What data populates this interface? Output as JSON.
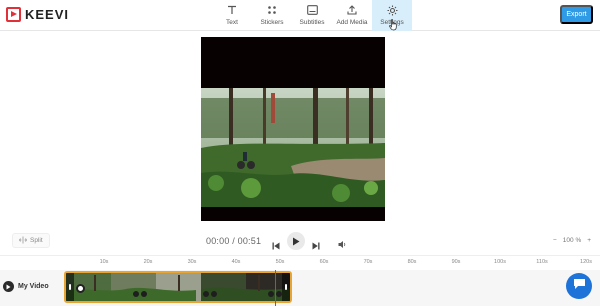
{
  "app": {
    "brand": "KEEVI"
  },
  "toolbar": {
    "tools": [
      {
        "label": "Text"
      },
      {
        "label": "Stickers"
      },
      {
        "label": "Subtitles"
      },
      {
        "label": "Add Media"
      },
      {
        "label": "Settings"
      }
    ],
    "active_tool": "Settings",
    "export_label": "Export"
  },
  "controls": {
    "split_label": "Split",
    "time_display": "00:00 / 00:51",
    "zoom_minus": "−",
    "zoom_value": "100 %",
    "zoom_plus": "+"
  },
  "timeline": {
    "ruler_labels": [
      "10s",
      "20s",
      "30s",
      "40s",
      "50s",
      "60s",
      "70s",
      "80s",
      "90s",
      "100s",
      "110s",
      "120s"
    ],
    "track_label": "My Video"
  },
  "colors": {
    "accent": "#2f9ae6",
    "brand_red": "#e0303a",
    "clip_border": "#e9a534",
    "active_tab_bg": "#d8eefa",
    "chat_blue": "#1d73d8"
  }
}
